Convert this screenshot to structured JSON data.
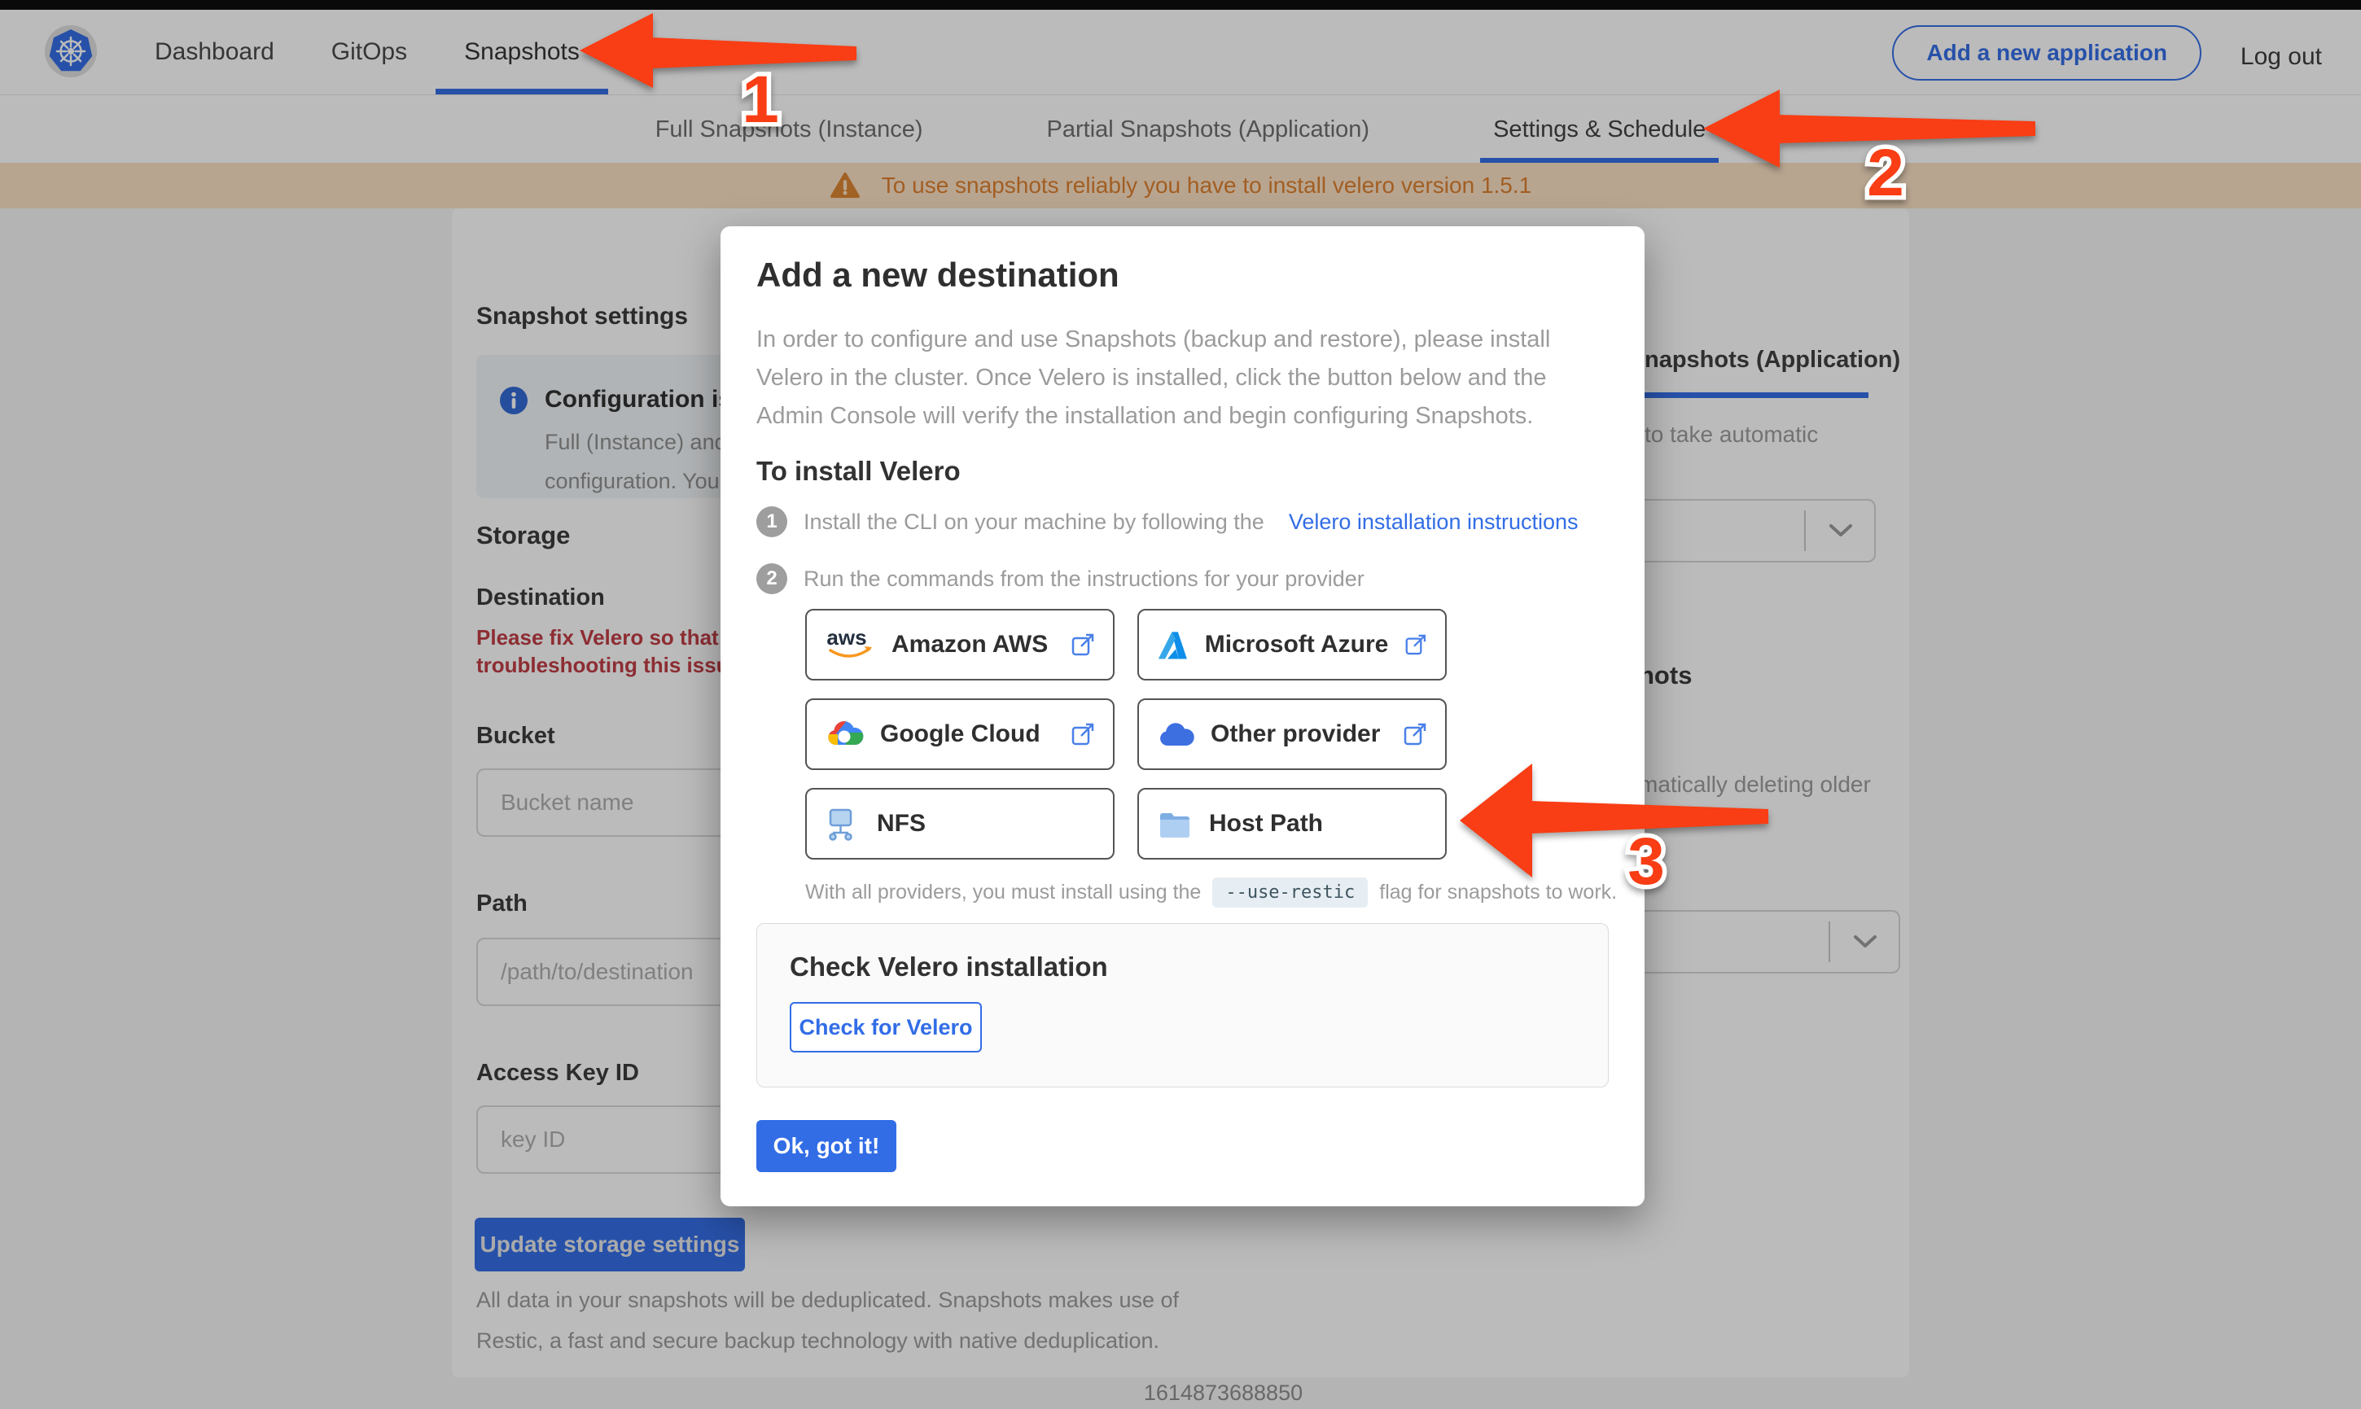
{
  "topnav": {
    "items": [
      {
        "label": "Dashboard"
      },
      {
        "label": "GitOps"
      },
      {
        "label": "Snapshots"
      }
    ],
    "add_app_label": "Add a new application",
    "logout_label": "Log out"
  },
  "subnav": {
    "tabs": [
      {
        "label": "Full Snapshots (Instance)"
      },
      {
        "label": "Partial Snapshots (Application)"
      },
      {
        "label": "Settings & Schedule"
      }
    ]
  },
  "banner": {
    "text": "To use snapshots reliably you have to install velero version 1.5.1"
  },
  "settings_page": {
    "title": "Snapshot settings",
    "info_heading": "Configuration is sh",
    "info_line1": "Full (Instance) and Parti",
    "info_line2": "configuration. Your stor",
    "storage_heading": "Storage",
    "destination_label": "Destination",
    "error_line1": "Please fix Velero so that th",
    "error_line2": "troubleshooting this issue",
    "bucket_label": "Bucket",
    "bucket_placeholder": "Bucket name",
    "path_label": "Path",
    "path_placeholder": "/path/to/destination",
    "access_key_label": "Access Key ID",
    "access_key_placeholder": "key ID",
    "update_button": "Update storage settings",
    "footnote_line1": "All data in your snapshots will be deduplicated. Snapshots makes use of",
    "footnote_line2": "Restic, a fast and secure backup technology with native deduplication."
  },
  "schedule_panel": {
    "partial_tab": "napshots (Application)",
    "hint1": "to take automatic",
    "heading_partial": "hots",
    "hint2": "matically deleting older"
  },
  "modal": {
    "title": "Add a new destination",
    "body": "In order to configure and use Snapshots (backup and restore), please install\nVelero in the cluster. Once Velero is installed, click the button below and the\nAdmin Console will verify the installation and begin configuring Snapshots.",
    "install_heading": "To install Velero",
    "step1": {
      "num": "1",
      "text": "Install the CLI on your machine by following the",
      "link": "Velero installation instructions"
    },
    "step2": {
      "num": "2",
      "text": "Run the commands from the instructions for your provider"
    },
    "providers": [
      {
        "name": "Amazon AWS",
        "icon": "aws-icon",
        "external": true
      },
      {
        "name": "Microsoft Azure",
        "icon": "azure-icon",
        "external": true
      },
      {
        "name": "Google Cloud",
        "icon": "google-cloud-icon",
        "external": true
      },
      {
        "name": "Other provider",
        "icon": "cloud-icon",
        "external": true
      },
      {
        "name": "NFS",
        "icon": "nfs-icon",
        "external": false
      },
      {
        "name": "Host Path",
        "icon": "folder-icon",
        "external": false
      }
    ],
    "restic_prefix": "With all providers, you must install using the",
    "restic_code": "--use-restic",
    "restic_suffix": "flag for snapshots to work.",
    "check_heading": "Check Velero installation",
    "check_button": "Check for Velero",
    "ok_button": "Ok, got it!"
  },
  "annotations": {
    "arrow1_label": "1",
    "arrow2_label": "2",
    "arrow3_label": "3"
  },
  "footer": {
    "timestamp": "1614873688850"
  },
  "colors": {
    "primary_blue": "#326DE6",
    "arrow_red": "#F93D14",
    "banner_bg": "#FBE1C4",
    "banner_text": "#DD7F2B",
    "error_red": "#BF3B43"
  }
}
